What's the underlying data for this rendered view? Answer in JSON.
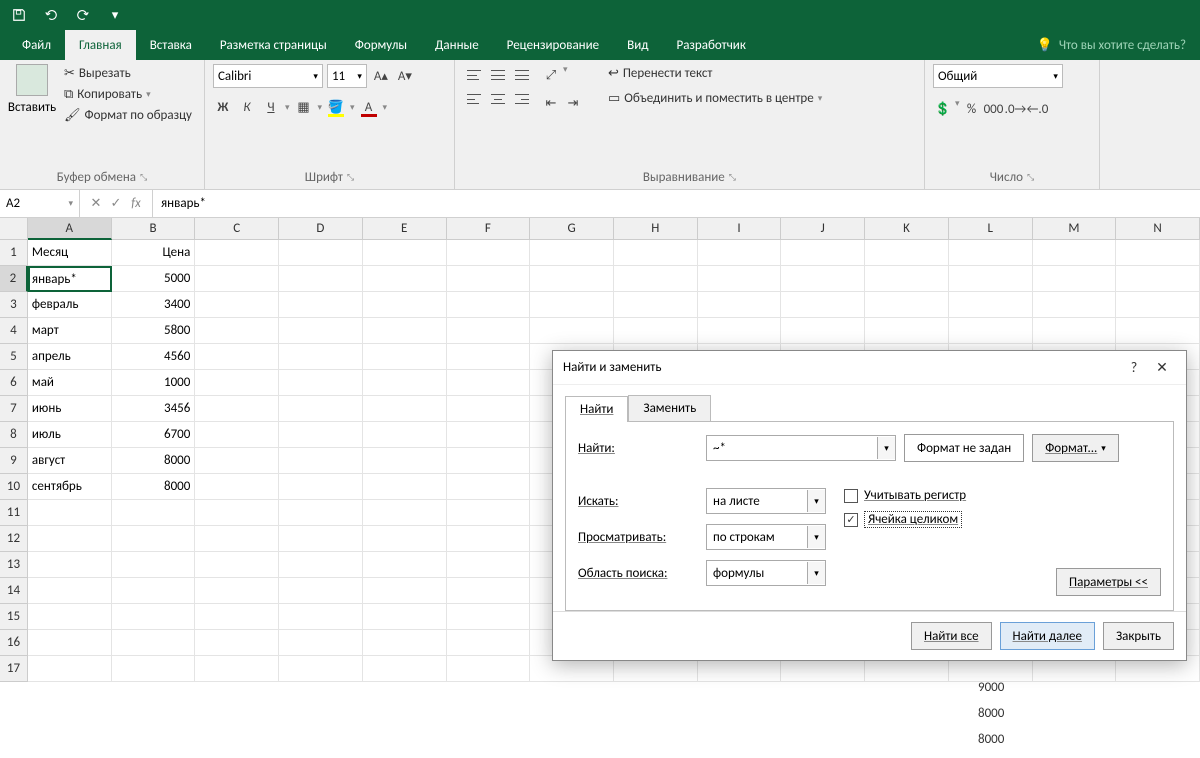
{
  "qat": {
    "save": "save-icon",
    "undo": "undo-icon",
    "redo": "redo-icon"
  },
  "tabs": {
    "file": "Файл",
    "home": "Главная",
    "insert": "Вставка",
    "layout": "Разметка страницы",
    "formulas": "Формулы",
    "data": "Данные",
    "review": "Рецензирование",
    "view": "Вид",
    "developer": "Разработчик",
    "tell_me": "Что вы хотите сделать?"
  },
  "ribbon": {
    "paste": "Вставить",
    "cut": "Вырезать",
    "copy": "Копировать",
    "format_painter": "Формат по образцу",
    "clipboard_label": "Буфер обмена",
    "font_name": "Calibri",
    "font_size": "11",
    "bold": "Ж",
    "italic": "К",
    "underline": "Ч",
    "font_label": "Шрифт",
    "wrap_text": "Перенести текст",
    "merge_center": "Объединить и поместить в центре",
    "alignment_label": "Выравнивание",
    "number_format": "Общий",
    "percent": "%",
    "thousands": "000",
    "number_label": "Число"
  },
  "name_box": "A2",
  "formula": "январь*",
  "columns": [
    "A",
    "B",
    "C",
    "D",
    "E",
    "F",
    "G",
    "H",
    "I",
    "J",
    "K",
    "L",
    "M",
    "N"
  ],
  "rows": [
    {
      "n": "1",
      "a": "Месяц",
      "b": "Цена"
    },
    {
      "n": "2",
      "a": "январь*",
      "b": "5000",
      "active": true
    },
    {
      "n": "3",
      "a": "февраль",
      "b": "3400"
    },
    {
      "n": "4",
      "a": "март",
      "b": "5800"
    },
    {
      "n": "5",
      "a": "апрель",
      "b": "4560"
    },
    {
      "n": "6",
      "a": "май",
      "b": "1000"
    },
    {
      "n": "7",
      "a": "июнь",
      "b": "3456"
    },
    {
      "n": "8",
      "a": "июль",
      "b": "6700"
    },
    {
      "n": "9",
      "a": "август",
      "b": "8000"
    },
    {
      "n": "10",
      "a": "сентябрь",
      "b": "8000"
    },
    {
      "n": "11",
      "a": "",
      "b": ""
    },
    {
      "n": "12",
      "a": "",
      "b": ""
    },
    {
      "n": "13",
      "a": "",
      "b": ""
    },
    {
      "n": "14",
      "a": "",
      "b": ""
    },
    {
      "n": "15",
      "a": "",
      "b": ""
    },
    {
      "n": "16",
      "a": "",
      "b": ""
    },
    {
      "n": "17",
      "a": "",
      "b": ""
    }
  ],
  "overflow": [
    "9000",
    "8000",
    "8000"
  ],
  "dialog": {
    "title": "Найти и заменить",
    "tab_find": "Найти",
    "tab_replace": "Заменить",
    "find_label": "Найти:",
    "find_value": "~*",
    "format_not_set": "Формат не задан",
    "format_btn": "Формат...",
    "search_label": "Искать:",
    "search_value": "на листе",
    "look_label": "Просматривать:",
    "look_value": "по строкам",
    "area_label": "Область поиска:",
    "area_value": "формулы",
    "match_case": "Учитывать регистр",
    "whole_cell": "Ячейка целиком",
    "params": "Параметры <<",
    "find_all": "Найти все",
    "find_next": "Найти далее",
    "close": "Закрыть"
  }
}
